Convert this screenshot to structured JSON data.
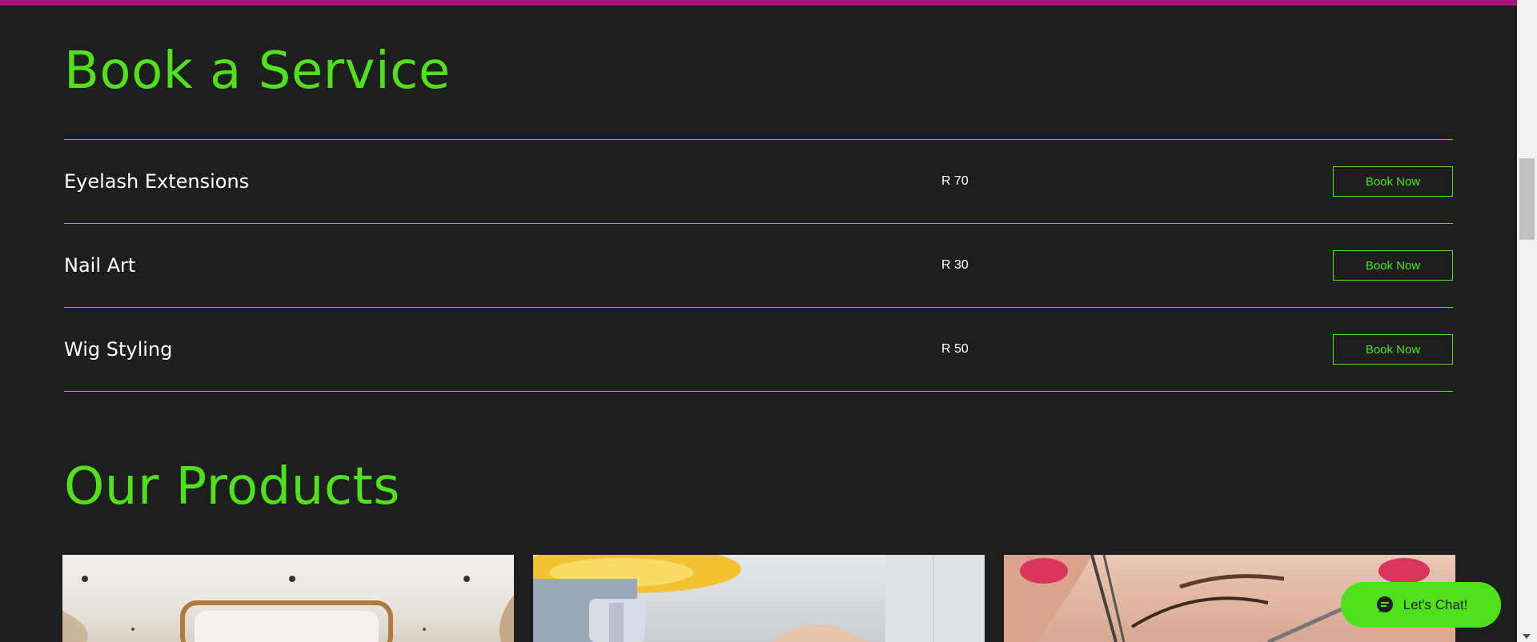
{
  "colors": {
    "accent": "#4fe21a",
    "background": "#1e1e1e",
    "topbar": "#a6167f",
    "text": "#ffffff"
  },
  "book_section": {
    "title": "Book a Service",
    "services": [
      {
        "name": "Eyelash Extensions",
        "price": "R 70",
        "button": "Book Now"
      },
      {
        "name": "Nail Art",
        "price": "R 30",
        "button": "Book Now"
      },
      {
        "name": "Wig Styling",
        "price": "R 50",
        "button": "Book Now"
      }
    ]
  },
  "products_section": {
    "title": "Our Products"
  },
  "chat": {
    "label": "Let's Chat!",
    "icon": "chat-bubble-icon"
  }
}
